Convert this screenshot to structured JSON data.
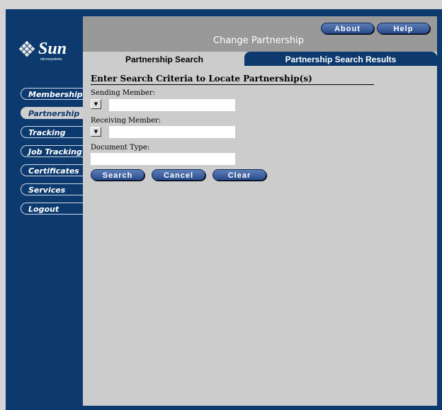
{
  "header": {
    "page_title": "Change Partnership",
    "about_label": "About",
    "help_label": "Help"
  },
  "logo": {
    "brand": "Sun",
    "tagline": "microsystems"
  },
  "sidebar": {
    "items": [
      {
        "label": "Membership",
        "active": false
      },
      {
        "label": "Partnership",
        "active": true
      },
      {
        "label": "Tracking",
        "active": false
      },
      {
        "label": "Job Tracking",
        "active": false
      },
      {
        "label": "Certificates",
        "active": false
      },
      {
        "label": "Services",
        "active": false
      },
      {
        "label": "Logout",
        "active": false
      }
    ]
  },
  "tabs": [
    {
      "label": "Partnership Search",
      "active": true
    },
    {
      "label": "Partnership Search Results",
      "active": false
    }
  ],
  "form": {
    "section_title": "Enter Search Criteria to Locate Partnership(s)",
    "sending_label": "Sending Member:",
    "sending_value": "",
    "receiving_label": "Receiving Member:",
    "receiving_value": "",
    "doctype_label": "Document Type:",
    "doctype_value": "",
    "search_label": "Search",
    "cancel_label": "Cancel",
    "clear_label": "Clear"
  },
  "colors": {
    "navy": "#0d3a6e",
    "panel": "#cccccc",
    "header": "#999999",
    "button": "#2b4c8c"
  }
}
